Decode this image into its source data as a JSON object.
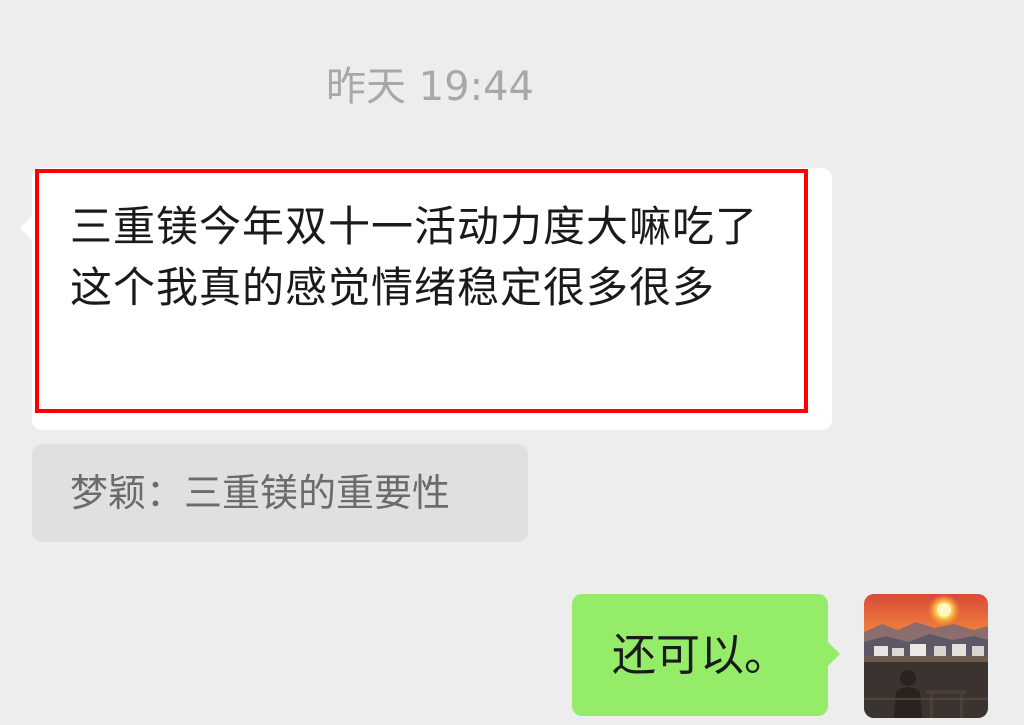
{
  "chat": {
    "timestamp": "昨天 19:44",
    "incoming_message": {
      "text": "三重镁今年双十一活动力度大嘛吃了这个我真的感觉情绪稳定很多很多",
      "highlighted": true
    },
    "quote": {
      "text": "梦颖：三重镁的重要性"
    },
    "outgoing_message": {
      "text": "还可以。"
    },
    "avatar": {
      "icon": "sunset-landscape-photo"
    }
  },
  "colors": {
    "background": "#ededed",
    "incoming_bubble": "#ffffff",
    "outgoing_bubble": "#95ec69",
    "quote_bubble": "#e0e0e0",
    "highlight": "#ff0000",
    "timestamp_text": "#a8a8a8"
  }
}
